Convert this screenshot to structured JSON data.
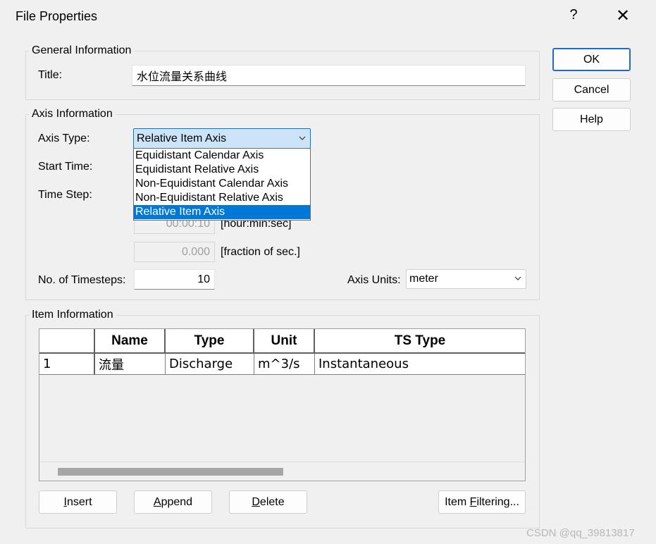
{
  "window": {
    "title": "File Properties",
    "help_glyph": "?",
    "close_glyph": "✕"
  },
  "buttons": {
    "ok": "OK",
    "cancel": "Cancel",
    "help": "Help"
  },
  "general": {
    "legend": "General Information",
    "title_label": "Title:",
    "title_value": "水位流量关系曲线"
  },
  "axis": {
    "legend": "Axis Information",
    "type_label": "Axis Type:",
    "type_value": "Relative Item Axis",
    "options": [
      "Equidistant Calendar Axis",
      "Equidistant Relative Axis",
      "Non-Equidistant Calendar Axis",
      "Non-Equidistant Relative Axis",
      "Relative Item Axis"
    ],
    "selected_option": "Relative Item Axis",
    "start_time_label": "Start Time:",
    "time_step_label": "Time Step:",
    "time_step_value": "00:00:10",
    "time_step_unit": "[hour:min:sec]",
    "fraction_value": "0.000",
    "fraction_unit": "[fraction of sec.]",
    "timesteps_label": "No. of Timesteps:",
    "timesteps_value": "10",
    "units_label": "Axis Units:",
    "units_value": "meter"
  },
  "items": {
    "legend": "Item Information",
    "columns": [
      "Name",
      "Type",
      "Unit",
      "TS Type"
    ],
    "rows": [
      {
        "index": "1",
        "name": "流量",
        "type": "Discharge",
        "unit": "m^3/s",
        "ts_type": "Instantaneous"
      }
    ],
    "insert": {
      "pre": "",
      "key": "I",
      "post": "nsert"
    },
    "append": {
      "pre": "",
      "key": "A",
      "post": "ppend"
    },
    "delete": {
      "pre": "",
      "key": "D",
      "post": "elete"
    },
    "filtering": {
      "pre": "Item ",
      "key": "F",
      "post": "iltering..."
    }
  },
  "watermark": "CSDN @qq_39813817",
  "colors": {
    "accent": "#0078d7",
    "combo_active_bg": "#cce4f7",
    "background": "#f0f0f0"
  }
}
